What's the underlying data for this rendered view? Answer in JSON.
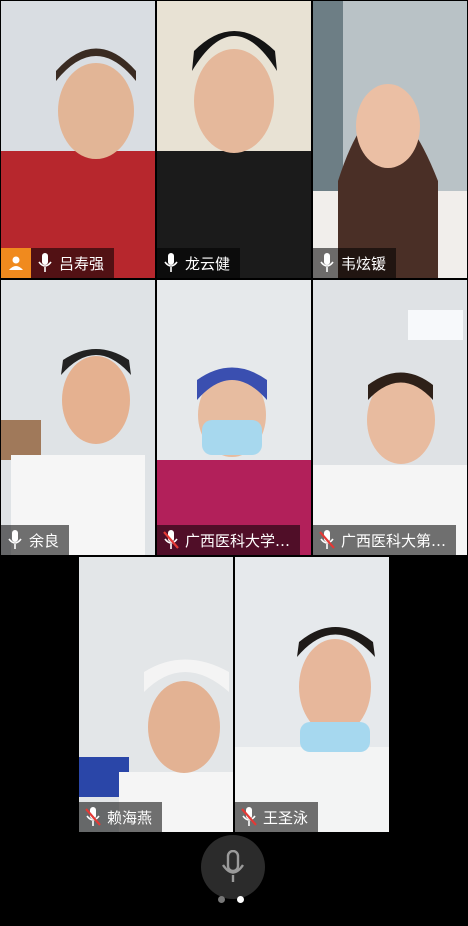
{
  "participants": [
    {
      "name": "吕寿强",
      "muted": false,
      "is_host": true
    },
    {
      "name": "龙云健",
      "muted": false
    },
    {
      "name": "韦炫锾",
      "muted": false
    },
    {
      "name": "余良",
      "muted": false,
      "active_speaker": true
    },
    {
      "name": "广西医科大学…",
      "muted": true
    },
    {
      "name": "广西医科大第…",
      "muted": true
    },
    {
      "name": "赖海燕",
      "muted": true
    },
    {
      "name": "王圣泳",
      "muted": true
    }
  ],
  "controls": {
    "mic_button": "microphone-icon",
    "page_indicator": {
      "pages": 2,
      "current": 2
    }
  },
  "colors": {
    "background": "#000000",
    "active_border": "#1fbf3a",
    "host_badge": "#f08a1e",
    "muted_mic": "#e53935",
    "label_bg": "rgba(0,0,0,0.55)"
  }
}
